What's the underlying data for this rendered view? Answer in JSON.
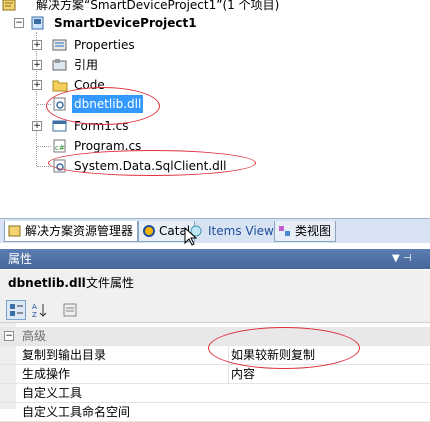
{
  "tree": {
    "solution_label": "解决方案“SmartDeviceProject1”(1 个项目)",
    "project_label": "SmartDeviceProject1",
    "items": [
      {
        "label": "Properties",
        "icon": "properties-icon"
      },
      {
        "label": "引用",
        "icon": "references-icon"
      },
      {
        "label": "Code",
        "icon": "folder-icon"
      },
      {
        "label": "dbnetlib.dll",
        "icon": "dll-icon",
        "selected": true
      },
      {
        "label": "Form1.cs",
        "icon": "form-icon"
      },
      {
        "label": "Program.cs",
        "icon": "cs-file-icon"
      },
      {
        "label": "System.Data.SqlClient.dll",
        "icon": "dll-icon"
      }
    ]
  },
  "tabs": [
    {
      "label": "解决方案资源管理器",
      "icon": "solution-explorer-icon",
      "active": true
    },
    {
      "label": "Catal",
      "icon": "catalog-icon"
    },
    {
      "label": "Items View",
      "icon": "items-view-icon"
    },
    {
      "label": "类视图",
      "icon": "class-view-icon"
    }
  ],
  "properties": {
    "title": "属性",
    "pin_glyph": "▼ ⊣",
    "object_name": "dbnetlib.dll",
    "object_type": "文件属性",
    "category": "高级",
    "rows": [
      {
        "name": "复制到输出目录",
        "value": "如果较新则复制"
      },
      {
        "name": "生成操作",
        "value": "内容"
      },
      {
        "name": "自定义工具",
        "value": ""
      },
      {
        "name": "自定义工具命名空间",
        "value": ""
      }
    ]
  },
  "colors": {
    "selection": "#3399ff",
    "annotation": "#e0303a",
    "header": "#4d6fa6"
  }
}
